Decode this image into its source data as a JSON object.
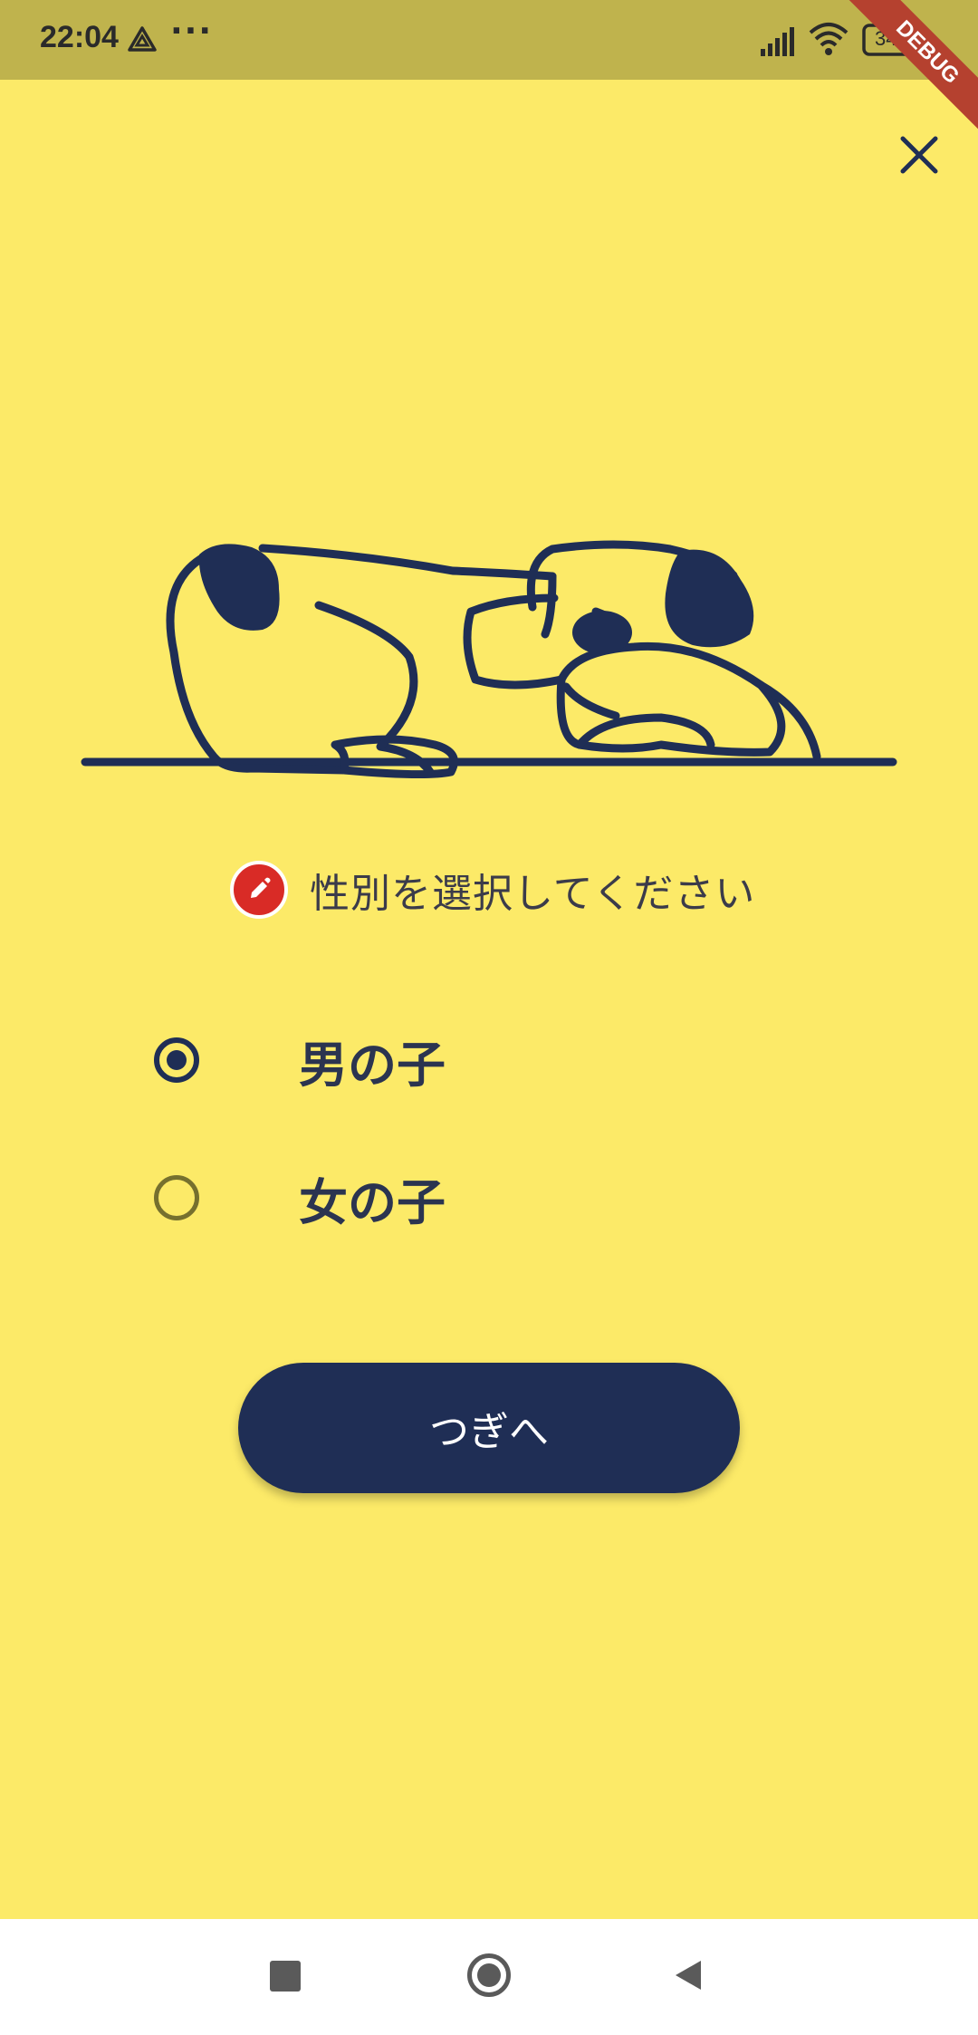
{
  "status_bar": {
    "time": "22:04",
    "overflow_dots": "···",
    "battery": "34",
    "icons": [
      "drive-icon",
      "signal-icon",
      "wifi-icon",
      "battery-icon"
    ]
  },
  "debug_banner": {
    "label": "DEBUG"
  },
  "close_button": {
    "icon": "close-icon"
  },
  "prompt": {
    "text": "性別を選択してください",
    "icon": "pencil-icon"
  },
  "gender_options": [
    {
      "label": "男の子",
      "selected": true
    },
    {
      "label": "女の子",
      "selected": false
    }
  ],
  "next_button": {
    "label": "つぎへ"
  },
  "nav_bar": {
    "icons": [
      "recent-apps-icon",
      "home-icon",
      "back-icon"
    ]
  },
  "colors": {
    "background": "#fcea68",
    "status_bar": "#bfb34d",
    "navy": "#1f2e55",
    "prompt_icon": "#d92b26",
    "debug_ribbon": "#b5412f"
  }
}
